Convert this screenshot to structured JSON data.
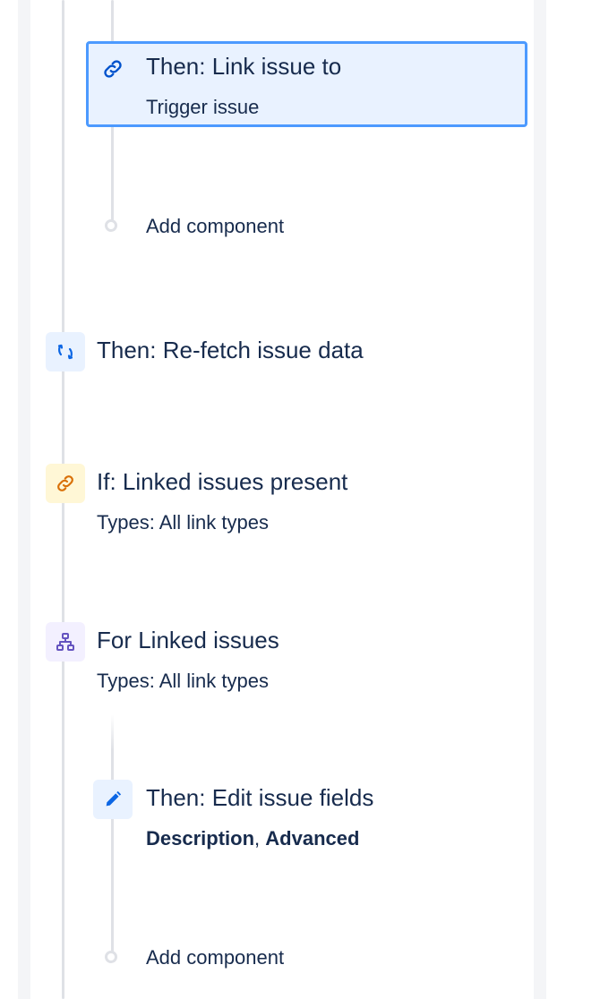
{
  "rule_components": {
    "link_issue": {
      "title": "Then: Link issue to",
      "subtitle": "Trigger issue",
      "icon": "link-icon"
    },
    "add_component_1": {
      "label": "Add component"
    },
    "refetch": {
      "title": "Then: Re-fetch issue data",
      "icon": "refresh-icon"
    },
    "linked_present": {
      "title": "If: Linked issues present",
      "subtitle": "Types: All link types",
      "icon": "link-icon"
    },
    "for_linked": {
      "title": "For Linked issues",
      "subtitle": "Types: All link types",
      "icon": "branch-icon"
    },
    "edit_fields": {
      "title": "Then: Edit issue fields",
      "field_1": "Description",
      "separator": ",",
      "field_2": "Advanced",
      "icon": "pencil-icon"
    },
    "add_component_2": {
      "label": "Add component"
    }
  },
  "colors": {
    "text": "#172b4d",
    "selected_border": "#4c9aff",
    "selected_bg": "#e9f2ff",
    "action_icon": "#0052cc",
    "action_icon_bg": "#e9f2ff",
    "condition_icon": "#d97008",
    "condition_icon_bg": "#fff7d6",
    "branch_icon": "#6554c0",
    "branch_icon_bg": "#f3f0ff",
    "line": "#dfe1e6",
    "panel_bg": "#f4f5f7"
  }
}
